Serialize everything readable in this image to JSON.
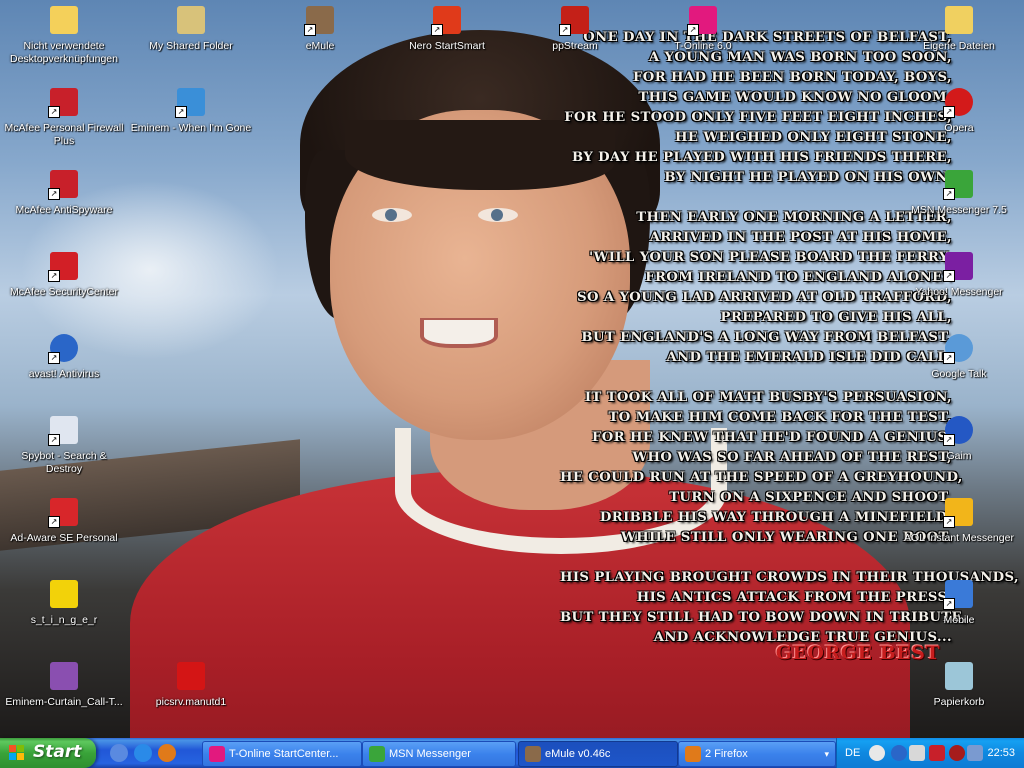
{
  "desktop": {
    "icons": [
      {
        "name": "icon-nicht-verwendete",
        "label": "Nicht verwendete Desktopverknüpfungen",
        "icon": "folder-icon",
        "color": "#f4d05a"
      },
      {
        "name": "icon-mcafee-firewall",
        "label": "McAfee Personal Firewall Plus",
        "icon": "mcafee-firewall-icon",
        "color": "#c8202a"
      },
      {
        "name": "icon-mcafee-antispyware",
        "label": "McAfee AntiSpyware",
        "icon": "mcafee-antispyware-icon",
        "color": "#c8202a"
      },
      {
        "name": "icon-mcafee-securitycenter",
        "label": "McAfee SecurityCenter",
        "icon": "mcafee-m-icon",
        "color": "#d21f26"
      },
      {
        "name": "icon-avast",
        "label": "avast! Antivirus",
        "icon": "avast-icon",
        "color": "#2a66c8"
      },
      {
        "name": "icon-spybot",
        "label": "Spybot - Search & Destroy",
        "icon": "spybot-icon",
        "color": "#e0e6f0"
      },
      {
        "name": "icon-adaware",
        "label": "Ad-Aware SE Personal",
        "icon": "adaware-icon",
        "color": "#d8262a"
      },
      {
        "name": "icon-stinger",
        "label": "s_t_i_n_g_e_r",
        "icon": "stinger-icon",
        "color": "#f2d20a"
      },
      {
        "name": "icon-eminem-curtain",
        "label": "Eminem-Curtain_Call-T...",
        "icon": "winrar-icon",
        "color": "#8a4fb0"
      },
      {
        "name": "icon-my-shared-folder",
        "label": "My Shared Folder",
        "icon": "shared-folder-icon",
        "color": "#d8c27a"
      },
      {
        "name": "icon-eminem-when-im-gone",
        "label": "Eminem - When I'm Gone",
        "icon": "media-file-icon",
        "color": "#3a8fd8"
      },
      {
        "name": "icon-picsrv",
        "label": "picsrv.manutd1",
        "icon": "red-splat-icon",
        "color": "#d41515"
      },
      {
        "name": "icon-emule",
        "label": "eMule",
        "icon": "emule-donkey-icon",
        "color": "#8a6a4a"
      },
      {
        "name": "icon-nero",
        "label": "Nero StartSmart",
        "icon": "nero-flame-icon",
        "color": "#e03a1a"
      },
      {
        "name": "icon-ppstream",
        "label": "ppStream",
        "icon": "ppstream-icon",
        "color": "#c42018"
      },
      {
        "name": "icon-t-online",
        "label": "T-Online 6.0",
        "icon": "t-online-icon",
        "color": "#e2197e"
      },
      {
        "name": "icon-eigene-dateien",
        "label": "Eigene Dateien",
        "icon": "my-documents-icon",
        "color": "#f0d060"
      },
      {
        "name": "icon-opera",
        "label": "Opera",
        "icon": "opera-icon",
        "color": "#d31a1a"
      },
      {
        "name": "icon-msn",
        "label": "MSN Messenger 7.5",
        "icon": "msn-buddies-icon",
        "color": "#3aa53a"
      },
      {
        "name": "icon-yahoo",
        "label": "Yahoo! Messenger",
        "icon": "yahoo-smiley-icon",
        "color": "#7b1fa2"
      },
      {
        "name": "icon-google-talk",
        "label": "Google Talk",
        "icon": "google-talk-icon",
        "color": "#5a9ad8"
      },
      {
        "name": "icon-gaim",
        "label": "Gaim",
        "icon": "gaim-icon",
        "color": "#2458c4"
      },
      {
        "name": "icon-aim",
        "label": "AOL Instant Messenger",
        "icon": "aim-runner-icon",
        "color": "#f2b51a"
      },
      {
        "name": "icon-mobile",
        "label": "Mobile",
        "icon": "mobile-device-icon",
        "color": "#3a7ad8"
      },
      {
        "name": "icon-papierkorb",
        "label": "Papierkorb",
        "icon": "recycle-bin-icon",
        "color": "#9cc6d8"
      }
    ]
  },
  "wallpaper": {
    "poem_lines": [
      "ONE DAY IN THE DARK STREETS OF BELFAST,",
      "A YOUNG MAN WAS BORN TOO SOON,",
      "FOR HAD HE BEEN BORN TODAY, BOYS,",
      "THIS GAME WOULD KNOW NO GLOOM.",
      "FOR HE STOOD ONLY FIVE FEET EIGHT INCHES,",
      "HE WEIGHED ONLY EIGHT STONE,",
      "BY DAY HE PLAYED WITH HIS FRIENDS THERE,",
      "BY NIGHT HE PLAYED ON HIS OWN.",
      "",
      "THEN EARLY ONE MORNING A LETTER,",
      "ARRIVED IN THE POST AT HIS HOME,",
      "'WILL YOUR SON PLEASE BOARD THE FERRY,",
      "FROM IRELAND TO ENGLAND ALONE'.",
      "SO A YOUNG LAD ARRIVED AT OLD TRAFFORD,",
      "PREPARED TO GIVE HIS ALL,",
      "BUT ENGLAND'S A LONG WAY FROM BELFAST,",
      "AND THE EMERALD ISLE DID CALL.",
      "",
      "IT TOOK ALL OF MATT BUSBY'S PERSUASION,",
      "TO MAKE HIM COME BACK FOR THE TEST,",
      "FOR HE KNEW THAT HE'D FOUND A GENIUS,",
      "WHO WAS SO FAR AHEAD OF THE REST,",
      "HE COULD RUN AT THE SPEED OF A GREYHOUND,",
      "TURN ON A SIXPENCE AND SHOOT,",
      "DRIBBLE HIS WAY THROUGH A MINEFIELD,",
      "WHILE STILL ONLY WEARING ONE BOOT.",
      "",
      "HIS PLAYING BROUGHT CROWDS IN THEIR THOUSANDS,",
      "HIS ANTICS ATTACK FROM THE PRESS,",
      "BUT THEY STILL HAD TO BOW DOWN IN TRIBUTE,",
      "AND ACKNOWLEDGE TRUE GENIUS..."
    ],
    "signature": "GEORGE BEST"
  },
  "taskbar": {
    "start_label": "Start",
    "quick_launch": [
      {
        "name": "quicklaunch-desktop-icon",
        "color": "#5a8ae0"
      },
      {
        "name": "quicklaunch-ie-icon",
        "color": "#2a8ae8"
      },
      {
        "name": "quicklaunch-firefox-icon",
        "color": "#e07a1a"
      }
    ],
    "tasks": [
      {
        "name": "task-t-online",
        "label": "T-Online StartCenter...",
        "icon": "t-online-icon",
        "color": "#e2197e",
        "active": false
      },
      {
        "name": "task-msn",
        "label": "MSN Messenger",
        "icon": "msn-buddies-icon",
        "color": "#3aa53a",
        "active": false
      },
      {
        "name": "task-emule",
        "label": "eMule v0.46c",
        "icon": "emule-donkey-icon",
        "color": "#8a6a4a",
        "active": true
      },
      {
        "name": "task-firefox",
        "label": "2 Firefox",
        "icon": "firefox-icon",
        "color": "#e07a1a",
        "active": false
      }
    ],
    "tray": {
      "language": "DE",
      "clock": "22:53"
    }
  }
}
